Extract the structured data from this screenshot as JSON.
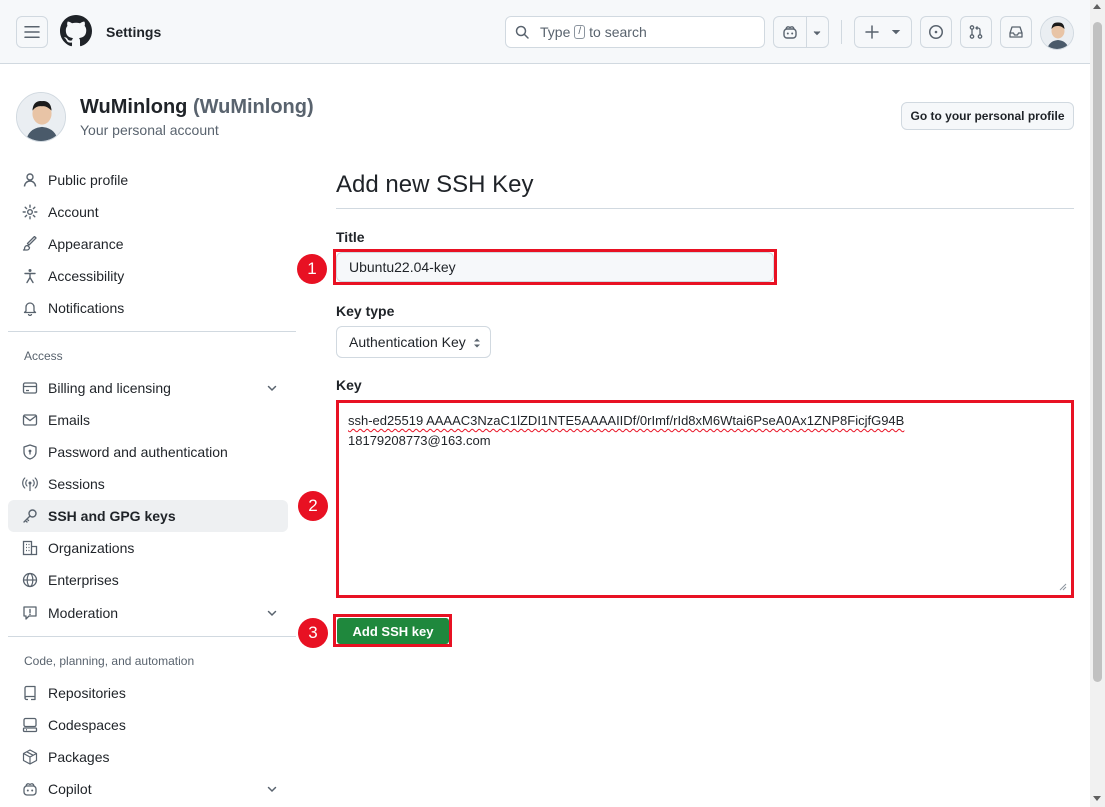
{
  "header": {
    "title": "Settings",
    "search_placeholder_prefix": "Type",
    "search_key": "/",
    "search_placeholder_suffix": "to search"
  },
  "account": {
    "name": "WuMinlong",
    "login": "(WuMinlong)",
    "subtitle": "Your personal account",
    "profile_button": "Go to your personal profile"
  },
  "sidebar": {
    "items": [
      {
        "label": "Public profile",
        "icon": "person-icon"
      },
      {
        "label": "Account",
        "icon": "gear-icon"
      },
      {
        "label": "Appearance",
        "icon": "paintbrush-icon"
      },
      {
        "label": "Accessibility",
        "icon": "accessibility-icon"
      },
      {
        "label": "Notifications",
        "icon": "bell-icon"
      }
    ],
    "access_heading": "Access",
    "access_items": [
      {
        "label": "Billing and licensing",
        "icon": "credit-card-icon"
      },
      {
        "label": "Emails",
        "icon": "mail-icon"
      },
      {
        "label": "Password and authentication",
        "icon": "shield-lock-icon"
      },
      {
        "label": "Sessions",
        "icon": "broadcast-icon"
      },
      {
        "label": "SSH and GPG keys",
        "icon": "key-icon"
      },
      {
        "label": "Organizations",
        "icon": "organization-icon"
      },
      {
        "label": "Enterprises",
        "icon": "globe-icon"
      },
      {
        "label": "Moderation",
        "icon": "report-icon"
      }
    ],
    "code_heading": "Code, planning, and automation",
    "code_items": [
      {
        "label": "Repositories",
        "icon": "repo-icon"
      },
      {
        "label": "Codespaces",
        "icon": "codespaces-icon"
      },
      {
        "label": "Packages",
        "icon": "package-icon"
      },
      {
        "label": "Copilot",
        "icon": "copilot-icon"
      }
    ]
  },
  "main": {
    "title": "Add new SSH Key",
    "title_label": "Title",
    "title_value": "Ubuntu22.04-key",
    "key_type_label": "Key type",
    "key_type_value": "Authentication Key",
    "key_label": "Key",
    "key_line1": "ssh-ed25519 AAAAC3NzaC1lZDI1NTE5AAAAIIDf/0rImf/rId8xM6Wtai6PseA0Ax1ZNP8FicjfG94B",
    "key_line2": "18179208773@163.com",
    "submit_label": "Add SSH key"
  },
  "annotations": [
    "1",
    "2",
    "3"
  ],
  "colors": {
    "accent": "#0969da",
    "primary_button": "#1f883d",
    "annotation_red": "#e81123"
  }
}
